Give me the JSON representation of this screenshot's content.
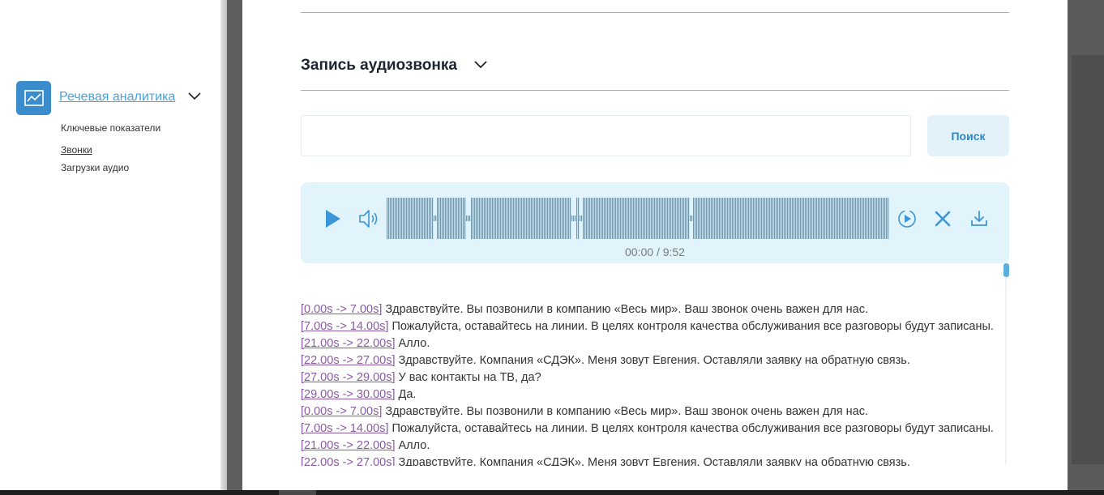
{
  "sidebar": {
    "section_title": "Речевая аналитика",
    "items": [
      {
        "label": "Ключевые показатели",
        "active": false
      },
      {
        "label": "Звонки",
        "active": true
      },
      {
        "label": "Загрузки аудио",
        "active": false
      }
    ],
    "icon": "chart-line-icon"
  },
  "modal": {
    "section_title": "Запись аудиозвонка",
    "search": {
      "value": "",
      "placeholder": "",
      "button_label": "Поиск"
    },
    "player": {
      "time": "00:00 / 9:52",
      "progress": 0,
      "icons": [
        "play-icon",
        "volume-icon",
        "playback-rate-icon",
        "close-icon",
        "download-icon"
      ]
    },
    "transcript": [
      {
        "time": "[0.00s -> 7.00s]",
        "text": " Здравствуйте. Вы позвонили в компанию «Весь мир». Ваш звонок очень важен для нас."
      },
      {
        "time": "[7.00s -> 14.00s]",
        "text": " Пожалуйста, оставайтесь на линии. В целях контроля качества обслуживания все разговоры будут записаны."
      },
      {
        "time": "[21.00s -> 22.00s]",
        "text": " Алло."
      },
      {
        "time": "[22.00s -> 27.00s]",
        "text": " Здравствуйте. Компания «СДЭК». Меня зовут Евгения. Оставляли заявку на обратную связь."
      },
      {
        "time": "[27.00s -> 29.00s]",
        "text": " У вас контакты на ТВ, да?"
      },
      {
        "time": "[29.00s -> 30.00s]",
        "text": " Да."
      },
      {
        "time": "[0.00s -> 7.00s]",
        "text": " Здравствуйте. Вы позвонили в компанию «Весь мир». Ваш звонок очень важен для нас."
      },
      {
        "time": "[7.00s -> 14.00s]",
        "text": " Пожалуйста, оставайтесь на линии. В целях контроля качества обслуживания все разговоры будут записаны."
      },
      {
        "time": "[21.00s -> 22.00s]",
        "text": " Алло."
      },
      {
        "time": "[22.00s -> 27.00s]",
        "text": " Здравствуйте. Компания «СДЭК». Меня зовут Евгения. Оставляли заявку на обратную связь."
      }
    ]
  },
  "colors": {
    "accent": "#4aa3d8",
    "player_bg": "#e1f3fb",
    "timestamp_link": "#8a5aa5"
  }
}
